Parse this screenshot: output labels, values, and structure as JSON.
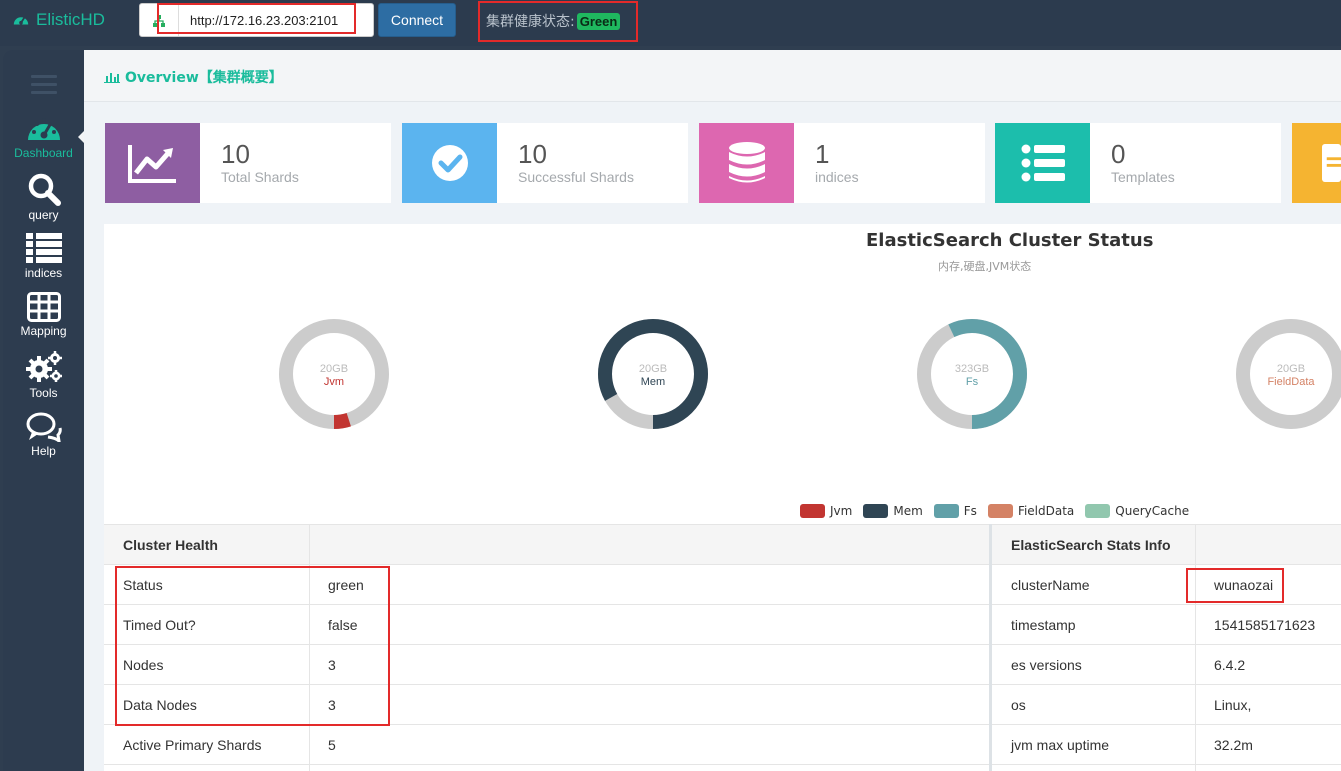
{
  "app": {
    "name": "ElisticHD"
  },
  "topbar": {
    "address_value": "http://172.16.23.203:2101",
    "connect_label": "Connect",
    "health_label": "集群健康状态:",
    "health_status": "Green"
  },
  "sidebar": {
    "items": [
      {
        "label": "Dashboard",
        "icon": "dashboard-icon",
        "active": true
      },
      {
        "label": "query",
        "icon": "search-icon"
      },
      {
        "label": "indices",
        "icon": "list-icon"
      },
      {
        "label": "Mapping",
        "icon": "table-icon"
      },
      {
        "label": "Tools",
        "icon": "gears-icon"
      },
      {
        "label": "Help",
        "icon": "chat-icon"
      }
    ]
  },
  "page": {
    "title": "Overview【集群概要】"
  },
  "cards": [
    {
      "value": "10",
      "label": "Total Shards",
      "color": "#8e5ea2",
      "icon": "line-chart-icon"
    },
    {
      "value": "10",
      "label": "Successful Shards",
      "color": "#5bb4ef",
      "icon": "check-circle-icon"
    },
    {
      "value": "1",
      "label": "indices",
      "color": "#dd67b0",
      "icon": "database-icon"
    },
    {
      "value": "0",
      "label": "Templates",
      "color": "#1cbeac",
      "icon": "list-icon"
    }
  ],
  "chart_data": {
    "type": "pie",
    "title": "ElasticSearch Cluster Status",
    "subtitle": "内存,硬盘,JVM状态",
    "donuts": [
      {
        "name": "Jvm",
        "total": "20GB",
        "used_fraction": 0.05,
        "color": "#c23531",
        "label_color": "#c23531"
      },
      {
        "name": "Mem",
        "total": "20GB",
        "used_fraction": 0.83,
        "color": "#2f4554",
        "label_color": "#2f4554"
      },
      {
        "name": "Fs",
        "total": "323GB",
        "used_fraction": 0.57,
        "color": "#61a0a8",
        "label_color": "#61a0a8"
      },
      {
        "name": "FieldData",
        "total": "20GB",
        "used_fraction": 0.0,
        "color": "#d48265",
        "label_color": "#d48265"
      }
    ],
    "legend": [
      {
        "name": "Jvm",
        "color": "#c23531"
      },
      {
        "name": "Mem",
        "color": "#2f4554"
      },
      {
        "name": "Fs",
        "color": "#61a0a8"
      },
      {
        "name": "FieldData",
        "color": "#d48265"
      },
      {
        "name": "QueryCache",
        "color": "#91c7ae"
      }
    ]
  },
  "cluster_health": {
    "header": "Cluster Health",
    "rows": [
      {
        "k": "Status",
        "v": "green"
      },
      {
        "k": "Timed Out?",
        "v": "false"
      },
      {
        "k": "Nodes",
        "v": "3"
      },
      {
        "k": "Data Nodes",
        "v": "3"
      },
      {
        "k": "Active Primary Shards",
        "v": "5"
      }
    ]
  },
  "stats_info": {
    "header": "ElasticSearch Stats Info",
    "rows": [
      {
        "k": "clusterName",
        "v": "wunaozai"
      },
      {
        "k": "timestamp",
        "v": "1541585171623"
      },
      {
        "k": "es versions",
        "v": "6.4.2"
      },
      {
        "k": "os",
        "v": "Linux,"
      },
      {
        "k": "jvm max uptime",
        "v": "32.2m"
      }
    ]
  }
}
